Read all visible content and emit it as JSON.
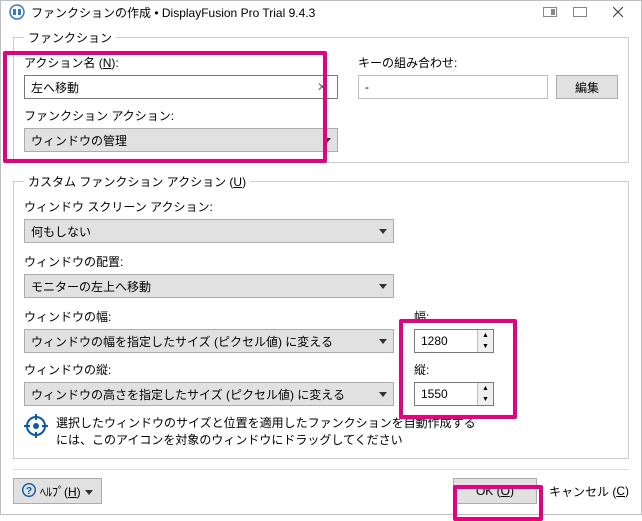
{
  "titlebar": {
    "title": "ファンクションの作成 • DisplayFusion Pro Trial 9.4.3"
  },
  "fieldset1": {
    "legend": "ファンクション",
    "action_name_label": "アクション名 (N):",
    "action_name_label_pre": "アクション名 (",
    "action_name_label_key": "N",
    "action_name_label_post": "):",
    "action_name_value": "左へ移動",
    "function_action_label": "ファンクション アクション:",
    "function_action_value": "ウィンドウの管理",
    "key_combo_label": "キーの組み合わせ:",
    "key_combo_value": "-",
    "edit_button": "編集"
  },
  "fieldset2": {
    "legend_pre": "カスタム ファンクション アクション (",
    "legend_key": "U",
    "legend_post": ")",
    "screen_action_label": "ウィンドウ スクリーン アクション:",
    "screen_action_value": "何もしない",
    "placement_label": "ウィンドウの配置:",
    "placement_value": "モニターの左上へ移動",
    "width_mode_label": "ウィンドウの幅:",
    "width_mode_value": "ウィンドウの幅を指定したサイズ (ピクセル値) に変える",
    "width_px_label": "幅:",
    "width_px_value": "1280",
    "height_mode_label": "ウィンドウの縦:",
    "height_mode_value": "ウィンドウの高さを指定したサイズ (ピクセル値) に変える",
    "height_px_label": "縦:",
    "height_px_value": "1550",
    "hint_text": "選択したウィンドウのサイズと位置を適用したファンクションを自動作成するには、このアイコンを対象のウィンドウにドラッグしてください"
  },
  "footer": {
    "help_pre": "ﾍﾙﾌﾟ(",
    "help_key": "H",
    "help_post": ")",
    "ok_pre": "OK (",
    "ok_key": "O",
    "ok_post": ")",
    "cancel_pre": "キャンセル (",
    "cancel_key": "C",
    "cancel_post": ")"
  }
}
